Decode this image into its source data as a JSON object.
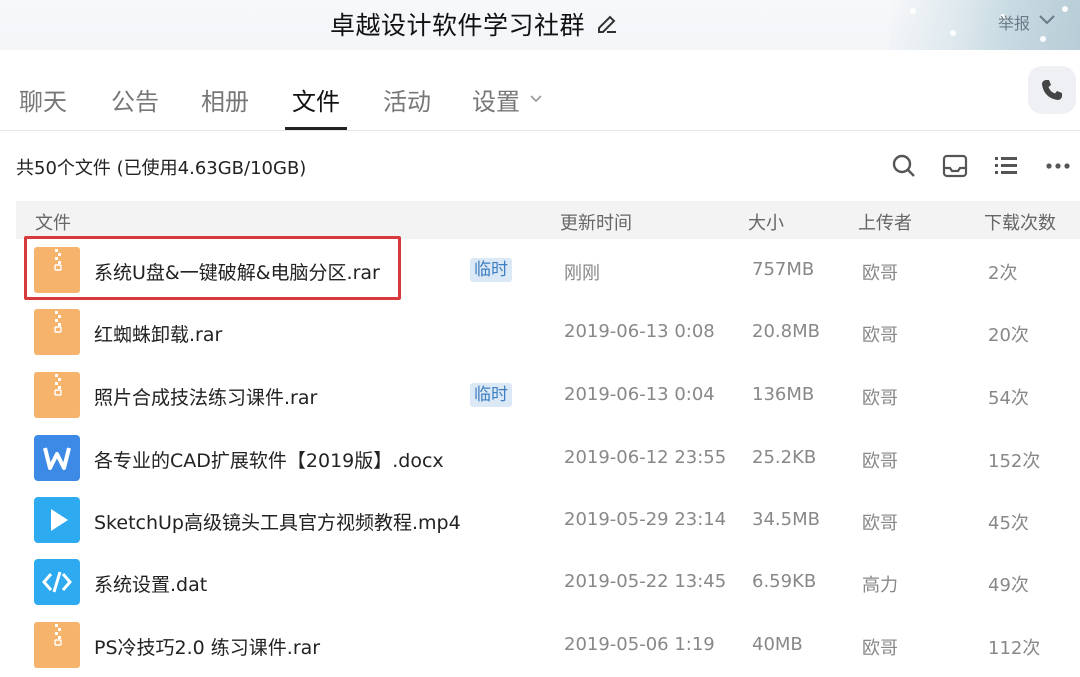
{
  "window": {
    "title": "卓越设计软件学习社群",
    "report_label": "举报"
  },
  "tabs": [
    {
      "label": "聊天"
    },
    {
      "label": "公告"
    },
    {
      "label": "相册"
    },
    {
      "label": "文件",
      "active": true
    },
    {
      "label": "活动"
    },
    {
      "label": "设置"
    }
  ],
  "summary": "共50个文件 (已使用4.63GB/10GB)",
  "columns": {
    "file": "文件",
    "updated": "更新时间",
    "size": "大小",
    "uploader": "上传者",
    "downloads": "下载次数"
  },
  "files": [
    {
      "name": "系统U盘&一键破解&电脑分区.rar",
      "icon": "zip-icon",
      "badge": "临时",
      "updated": "刚刚",
      "size": "757MB",
      "uploader": "欧哥",
      "downloads": "2次"
    },
    {
      "name": "红蜘蛛卸载.rar",
      "icon": "zip-icon",
      "badge": "",
      "updated": "2019-06-13 0:08",
      "size": "20.8MB",
      "uploader": "欧哥",
      "downloads": "20次"
    },
    {
      "name": "照片合成技法练习课件.rar",
      "icon": "zip-icon",
      "badge": "临时",
      "updated": "2019-06-13 0:04",
      "size": "136MB",
      "uploader": "欧哥",
      "downloads": "54次"
    },
    {
      "name": "各专业的CAD扩展软件【2019版】.docx",
      "icon": "word-icon",
      "badge": "",
      "updated": "2019-06-12 23:55",
      "size": "25.2KB",
      "uploader": "欧哥",
      "downloads": "152次"
    },
    {
      "name": "SketchUp高级镜头工具官方视频教程.mp4",
      "icon": "video-icon",
      "badge": "",
      "updated": "2019-05-29 23:14",
      "size": "34.5MB",
      "uploader": "欧哥",
      "downloads": "45次"
    },
    {
      "name": "系统设置.dat",
      "icon": "code-icon",
      "badge": "",
      "updated": "2019-05-22 13:45",
      "size": "6.59KB",
      "uploader": "高力",
      "downloads": "49次"
    },
    {
      "name": "PS冷技巧2.0 练习课件.rar",
      "icon": "zip-icon",
      "badge": "",
      "updated": "2019-05-06 1:19",
      "size": "40MB",
      "uploader": "欧哥",
      "downloads": "112次"
    }
  ],
  "colors": {
    "zip": "#f5b36b",
    "word": "#3d8ae6",
    "video": "#2eaaf0",
    "code": "#2eaaf0",
    "highlight": "#d8393a"
  }
}
